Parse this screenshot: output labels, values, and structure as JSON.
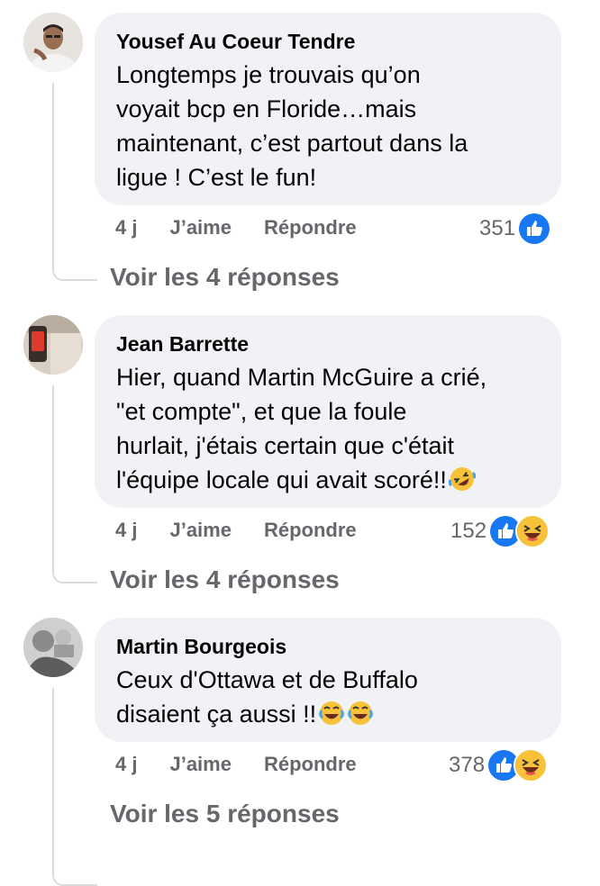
{
  "comments": [
    {
      "author": "Yousef Au Coeur Tendre",
      "lines": [
        "Longtemps je trouvais qu’on",
        "voyait bcp en Floride…mais",
        "maintenant, c’est partout dans la",
        "ligue ! C’est le fun!"
      ],
      "time": "4 j",
      "like_label": "J’aime",
      "reply_label": "Répondre",
      "reaction_count": "351",
      "reactions": [
        "like-icon"
      ],
      "view_replies": "Voir les 4 réponses"
    },
    {
      "author": "Jean Barrette",
      "lines": [
        "Hier, quand Martin McGuire a crié,",
        "\"et compte\", et que la foule",
        "hurlait, j'étais certain que c'était",
        "l'équipe locale qui avait scoré!!"
      ],
      "time": "4 j",
      "like_label": "J’aime",
      "reply_label": "Répondre",
      "reaction_count": "152",
      "reactions": [
        "like-icon",
        "haha-icon"
      ],
      "inline_emoji": [
        "rolling-laughing-emoji"
      ],
      "view_replies": "Voir les 4 réponses"
    },
    {
      "author": "Martin Bourgeois",
      "lines": [
        "Ceux d'Ottawa et de Buffalo",
        "disaient ça aussi !!"
      ],
      "time": "4 j",
      "like_label": "J’aime",
      "reply_label": "Répondre",
      "reaction_count": "378",
      "reactions": [
        "like-icon",
        "haha-icon"
      ],
      "inline_emoji": [
        "tears-of-joy-emoji",
        "tears-of-joy-emoji"
      ],
      "view_replies": "Voir les 5 réponses"
    }
  ],
  "colors": {
    "bubble": "#f0f2f5",
    "text": "#050505",
    "meta": "#65676b",
    "like_blue": "#1877f2",
    "haha_yellow": "#f7c23a"
  }
}
